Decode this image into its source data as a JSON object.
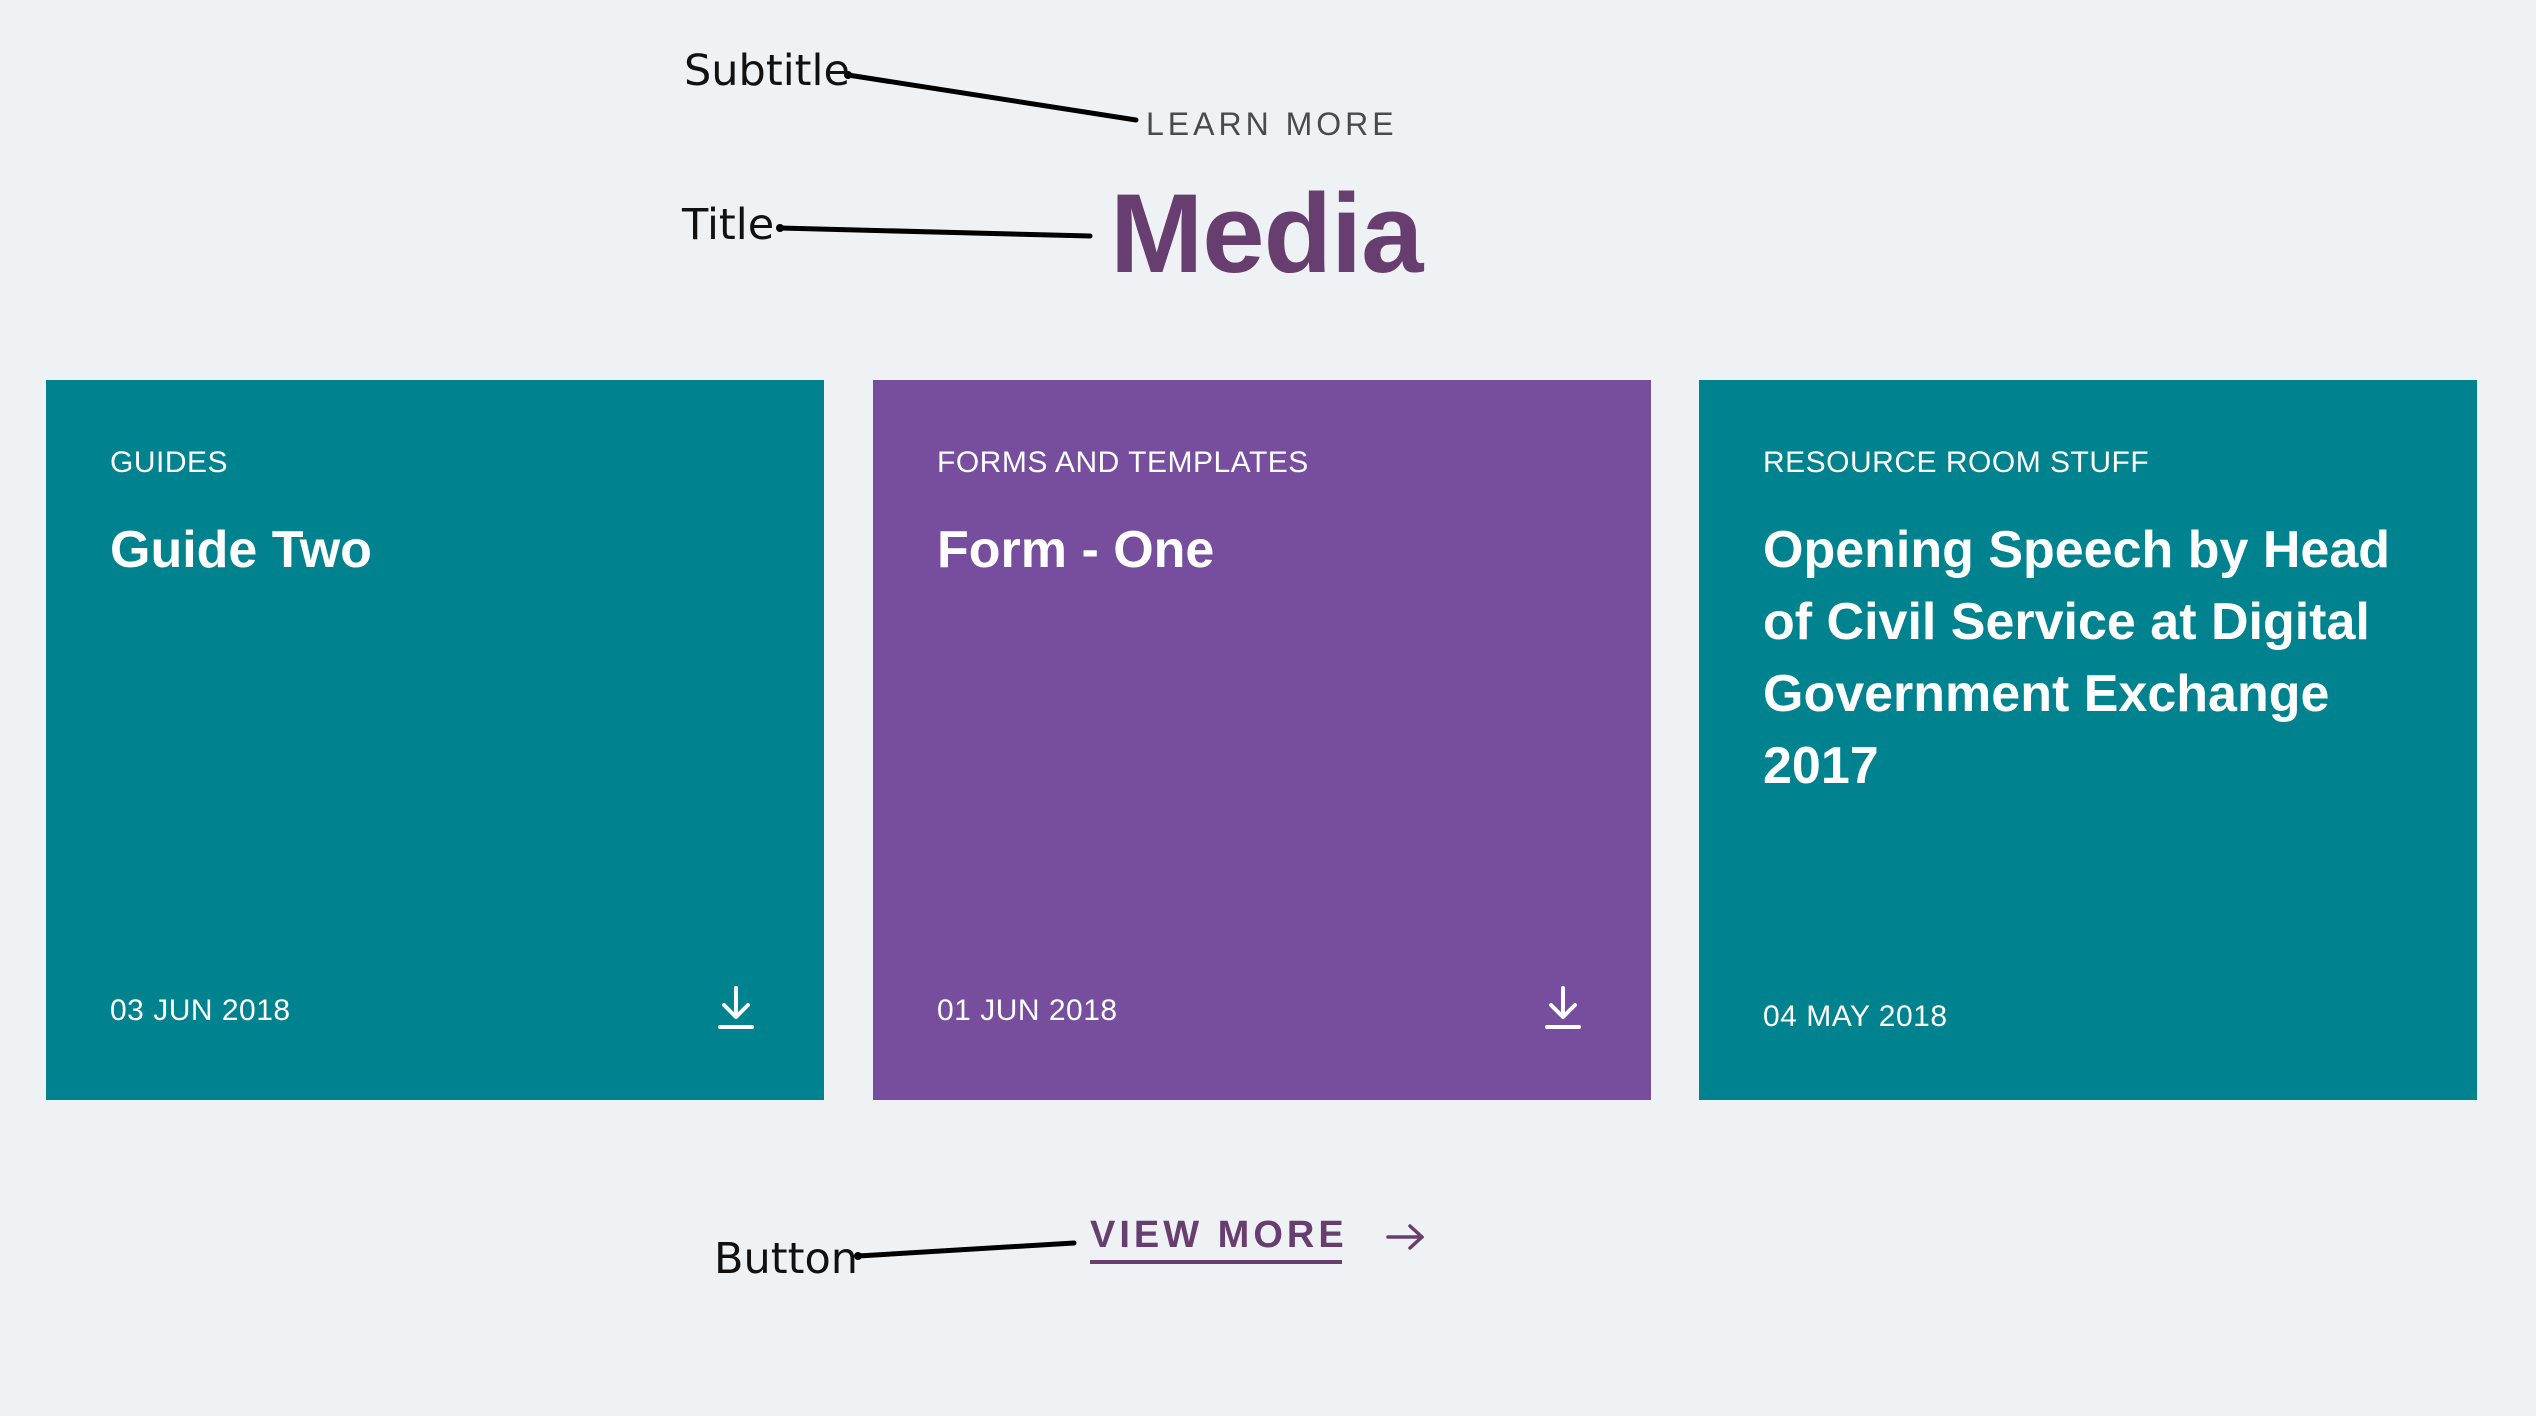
{
  "annotations": {
    "subtitle_label": "Subtitle",
    "title_label": "Title",
    "button_label": "Button"
  },
  "section": {
    "subtitle": "LEARN MORE",
    "title": "Media"
  },
  "cards": [
    {
      "category": "GUIDES",
      "title": "Guide Two",
      "date": "03 JUN 2018",
      "color": "#00838f",
      "has_download": true,
      "icon": "download-icon"
    },
    {
      "category": "FORMS AND TEMPLATES",
      "title": "Form - One",
      "date": "01 JUN 2018",
      "color": "#774e9e",
      "has_download": true,
      "icon": "download-icon"
    },
    {
      "category": "RESOURCE ROOM STUFF",
      "title": "Opening Speech by Head of Civil Service at Digital Government Exchange 2017",
      "date": "04 MAY 2018",
      "color": "#00838f",
      "has_download": false
    }
  ],
  "button": {
    "label": "VIEW MORE",
    "icon": "arrow-right-icon"
  },
  "colors": {
    "background": "#eff2f5",
    "accent": "#673e6f",
    "teal": "#00838f",
    "purple": "#774e9e"
  }
}
